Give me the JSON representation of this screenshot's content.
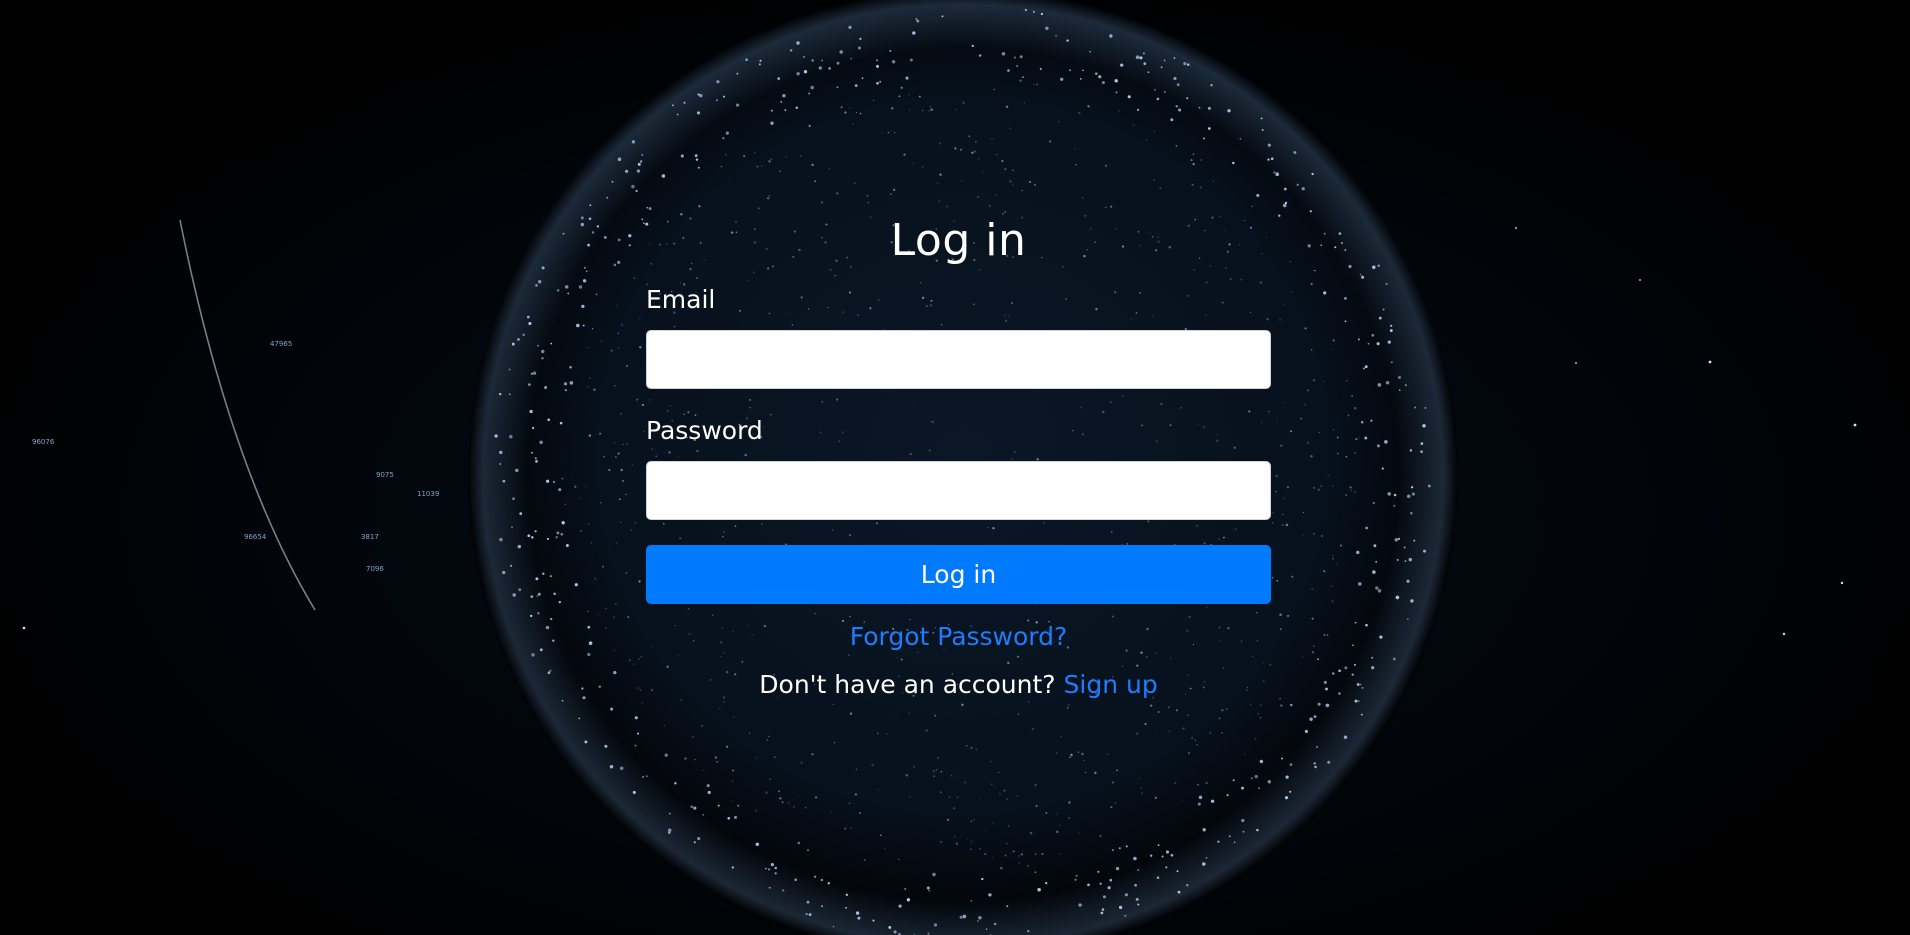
{
  "page": {
    "title": "Log in"
  },
  "form": {
    "email_label": "Email",
    "email_value": "",
    "password_label": "Password",
    "password_value": "",
    "submit_label": "Log in",
    "forgot_label": "Forgot Password?",
    "signup_prompt": "Don't have an account?",
    "signup_label": "Sign up"
  },
  "background": {
    "hud_numbers": [
      "47965",
      "96076",
      "9075",
      "11039",
      "96654",
      "3817",
      "7096"
    ]
  },
  "colors": {
    "background": "#000000",
    "accent": "#007bff",
    "link": "#1e7cff",
    "text": "#ffffff",
    "globe_glow": "#7fb6ff"
  }
}
